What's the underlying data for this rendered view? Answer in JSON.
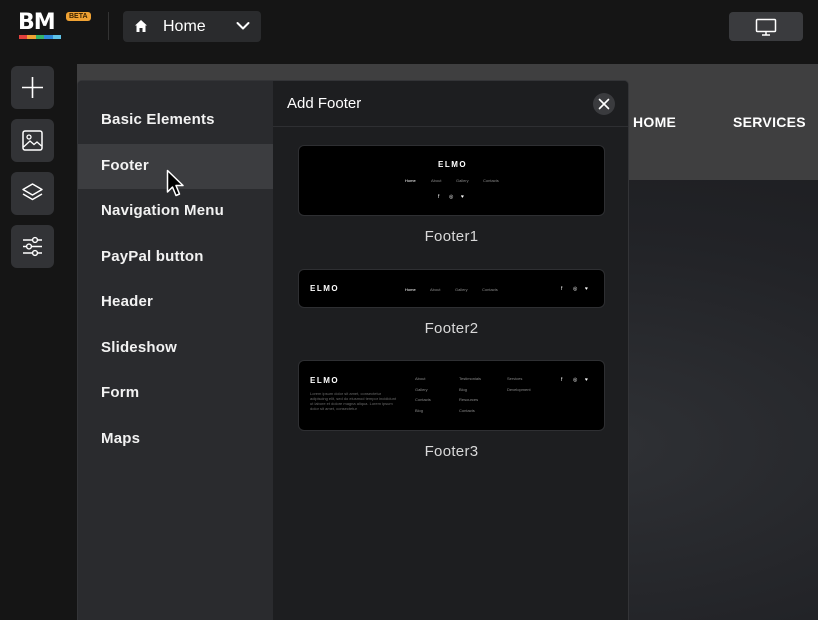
{
  "app": {
    "logo": "BM",
    "badge": "BETA",
    "brand_colors": [
      "#e2413d",
      "#f0a233",
      "#35b36a",
      "#2f89d9",
      "#5ec3e8"
    ]
  },
  "page_select": {
    "icon": "home-icon",
    "value": "Home"
  },
  "device_icon": "desktop-icon",
  "toolbar": [
    {
      "icon": "plus-icon"
    },
    {
      "icon": "image-icon"
    },
    {
      "icon": "layers-icon"
    },
    {
      "icon": "sliders-icon"
    }
  ],
  "site": {
    "nav": [
      "HOME",
      "SERVICES"
    ]
  },
  "panel": {
    "title": "Add Footer",
    "categories": [
      "Basic Elements",
      "Footer",
      "Navigation Menu",
      "PayPal button",
      "Header",
      "Slideshow",
      "Form",
      "Maps"
    ],
    "active_category": "Footer",
    "templates": [
      {
        "label": "Footer1"
      },
      {
        "label": "Footer2"
      },
      {
        "label": "Footer3"
      }
    ],
    "preview": {
      "brand": "ELMO",
      "links": [
        "Home",
        "About",
        "Gallery",
        "Contacts"
      ],
      "social": [
        "f",
        "◎",
        "♥"
      ],
      "f3_col1": [
        "About",
        "Gallery",
        "Contacts",
        "Blog"
      ],
      "f3_col2": [
        "Testimonials",
        "Blog",
        "Resources",
        "Contacts"
      ],
      "f3_col3": [
        "Services",
        "Development"
      ],
      "f3_desc": "Lorem ipsum dolor sit amet, consectetur adipiscing elit, sed do eiusmod tempor incididunt ut labore et dolore magna aliqua. Lorem ipsum dolor sit amet, consectetur"
    }
  }
}
